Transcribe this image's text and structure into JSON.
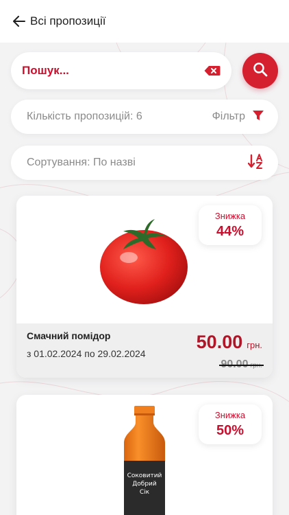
{
  "header": {
    "title": "Всі пропозиції"
  },
  "search": {
    "value": "Пошук..."
  },
  "count": {
    "label": "Кількість пропозицій: 6",
    "filter_label": "Фільтр"
  },
  "sort": {
    "label": "Сортування: По назві"
  },
  "offers": [
    {
      "discount_label": "Знижка",
      "discount_value": "44%",
      "name": "Смачний помідор",
      "dates": "з 01.02.2024 по 29.02.2024",
      "price_new": "50.00",
      "currency": "грн.",
      "price_old": "90.00",
      "currency_old": "грн."
    },
    {
      "discount_label": "Знижка",
      "discount_value": "50%",
      "bottle_label": [
        "Соковитий",
        "Добрий",
        "Сік"
      ]
    }
  ],
  "colors": {
    "accent": "#d4202f",
    "accent_dark": "#b01528",
    "background": "#f3f3f4"
  },
  "icons": [
    "back-arrow-icon",
    "clear-icon",
    "search-icon",
    "filter-funnel-icon",
    "sort-az-icon"
  ]
}
